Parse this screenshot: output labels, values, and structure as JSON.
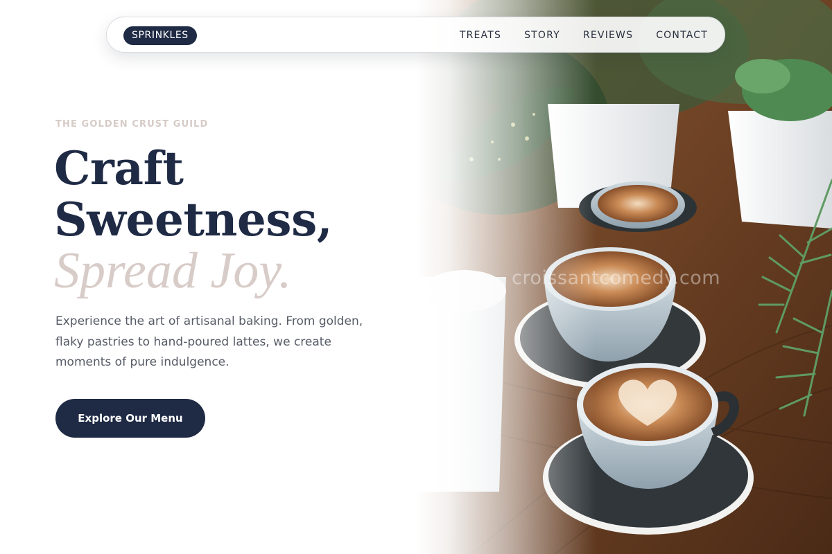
{
  "nav": {
    "brand": "SPRINKLES",
    "links": [
      "TREATS",
      "STORY",
      "REVIEWS",
      "CONTACT"
    ]
  },
  "hero": {
    "eyebrow": "THE GOLDEN CRUST GUILD",
    "headline_line1": "Craft",
    "headline_line2": "Sweetness,",
    "headline_accent": "Spread Joy.",
    "description": "Experience the art of artisanal baking. From golden, flaky pastries to hand-poured lattes, we create moments of pure indulgence.",
    "cta_label": "Explore Our Menu"
  },
  "image": {
    "watermark": "croissantcomedy.com",
    "subject": "latte cups with latte art on dark saucers on a wooden table with potted succulents"
  },
  "colors": {
    "navy": "#1f2a44",
    "accent_blush": "#d8ccc8",
    "body_text": "#565b66"
  }
}
